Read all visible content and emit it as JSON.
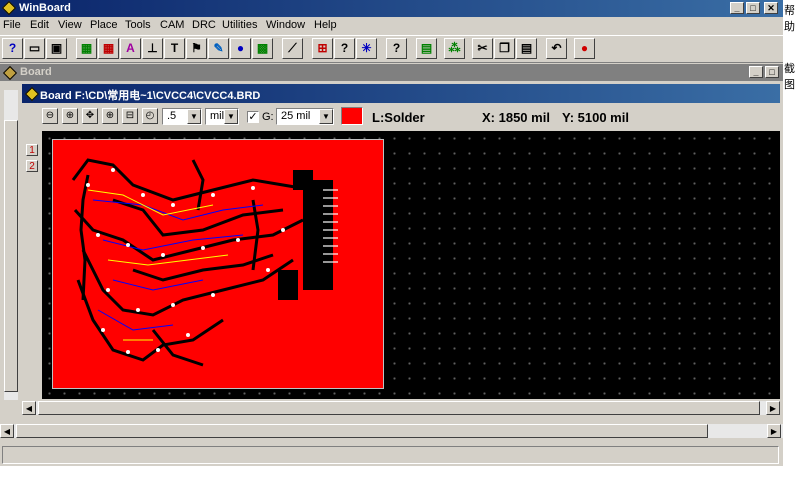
{
  "app": {
    "title": "WinBoard"
  },
  "menu": [
    "File",
    "Edit",
    "View",
    "Place",
    "Tools",
    "CAM",
    "DRC",
    "Utilities",
    "Window",
    "Help"
  ],
  "toolbar": {
    "buttons": [
      "help",
      "new",
      "save",
      "component",
      "library",
      "pattern",
      "pad",
      "text",
      "zoom",
      "rectangle",
      "layer",
      "wire",
      "place-part",
      "check",
      "net",
      "connect",
      "query",
      "report",
      "netlist",
      "cut",
      "copy",
      "paste",
      "undo",
      "color"
    ]
  },
  "board_frame": {
    "title": "Board"
  },
  "board_window": {
    "title": "Board F:\\CD\\常用电~1\\CVCC4\\CVCC4.BRD",
    "zoom_value": ".5",
    "unit_value": "mil",
    "grid_label": "G:",
    "grid_value": "25 mil",
    "layer_color": "#ff0000",
    "layer_label": "L:Solder",
    "x_readout": "X: 1850 mil",
    "y_readout": "Y: 5100 mil",
    "side_tabs": [
      "1",
      "2"
    ]
  },
  "outer_tabs": [
    "1",
    "2"
  ],
  "right_edge_text": [
    "帮助",
    "截图"
  ]
}
